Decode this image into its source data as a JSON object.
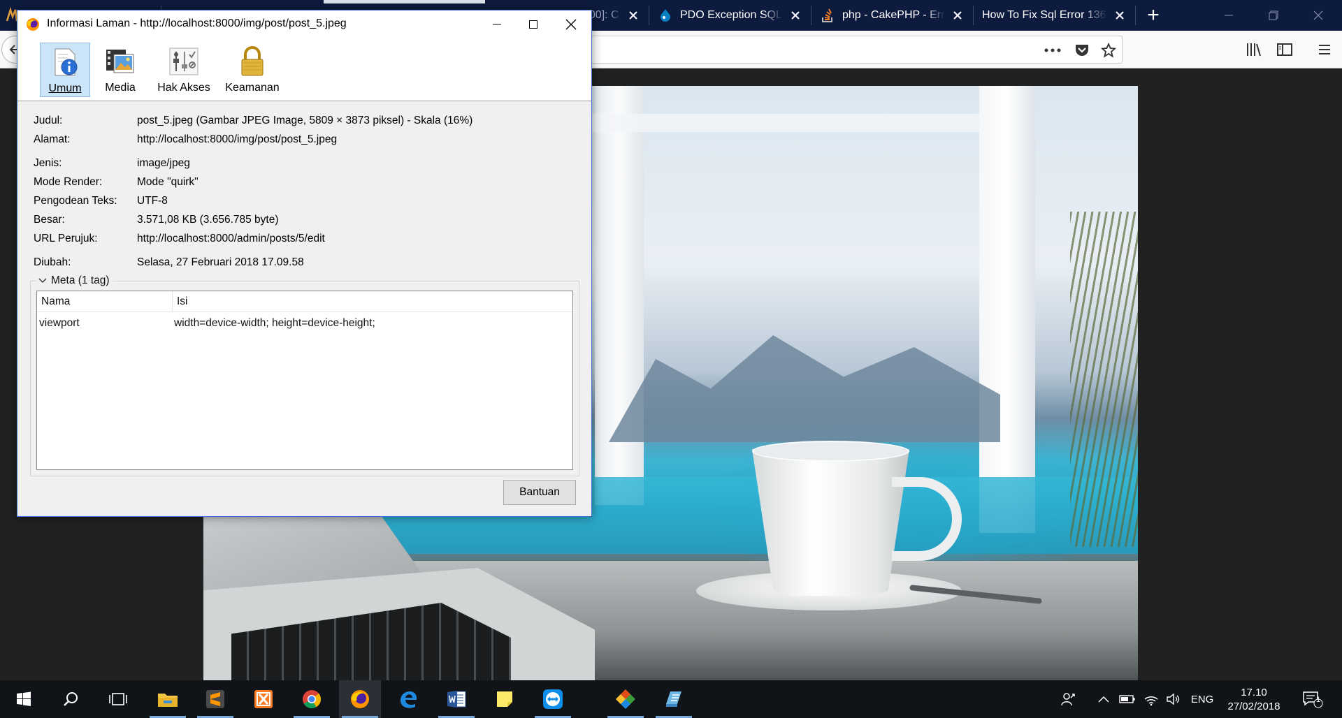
{
  "browser": {
    "tabs": [
      {
        "label": "…000]: C",
        "favicon": "generic-page-icon"
      },
      {
        "label": "PDO Exception SQL",
        "favicon": "drupal-icon"
      },
      {
        "label": "php - CakePHP - Err",
        "favicon": "stackoverflow-icon"
      },
      {
        "label": "How To Fix Sql Error 136",
        "favicon": "none"
      }
    ],
    "new_tab_label": "+",
    "url": ""
  },
  "dialog": {
    "title": "Informasi Laman - http://localhost:8000/img/post/post_5.jpeg",
    "tabs": [
      {
        "label": "Umum",
        "icon": "info-page-icon",
        "selected": true
      },
      {
        "label": "Media",
        "icon": "media-icon",
        "selected": false
      },
      {
        "label": "Hak Akses",
        "icon": "permissions-icon",
        "selected": false
      },
      {
        "label": "Keamanan",
        "icon": "padlock-icon",
        "selected": false
      }
    ],
    "info": [
      {
        "label": "Judul:",
        "value": "post_5.jpeg (Gambar JPEG Image, 5809 × 3873 piksel) - Skala (16%)"
      },
      {
        "label": "Alamat:",
        "value": "http://localhost:8000/img/post/post_5.jpeg"
      },
      {
        "label": "Jenis:",
        "value": "image/jpeg"
      },
      {
        "label": "Mode Render:",
        "value": "Mode \"quirk\""
      },
      {
        "label": "Pengodean Teks:",
        "value": "UTF-8"
      },
      {
        "label": "Besar:",
        "value": "3.571,08 KB (3.656.785 byte)"
      },
      {
        "label": "URL Perujuk:",
        "value": "http://localhost:8000/admin/posts/5/edit"
      },
      {
        "label": "Diubah:",
        "value": "Selasa, 27 Februari 2018 17.09.58"
      }
    ],
    "meta": {
      "header": "Meta (1 tag)",
      "columns": [
        "Nama",
        "Isi"
      ],
      "rows": [
        {
          "name": "viewport",
          "content": "width=device-width; height=device-height;"
        }
      ]
    },
    "help_button": "Bantuan"
  },
  "taskbar": {
    "apps": [
      "file-explorer-icon",
      "sublime-text-icon",
      "xampp-icon",
      "chrome-icon",
      "firefox-icon",
      "edge-icon",
      "word-icon",
      "sticky-notes-icon",
      "teamviewer-icon",
      "git-icon",
      "app-icon"
    ],
    "language": "ENG",
    "time": "17.10",
    "date": "27/02/2018",
    "notification_count": "1"
  },
  "colors": {
    "tabbar": "#0d1b3f",
    "taskbar": "#101317",
    "dialog_accent": "#3b6fd2"
  }
}
